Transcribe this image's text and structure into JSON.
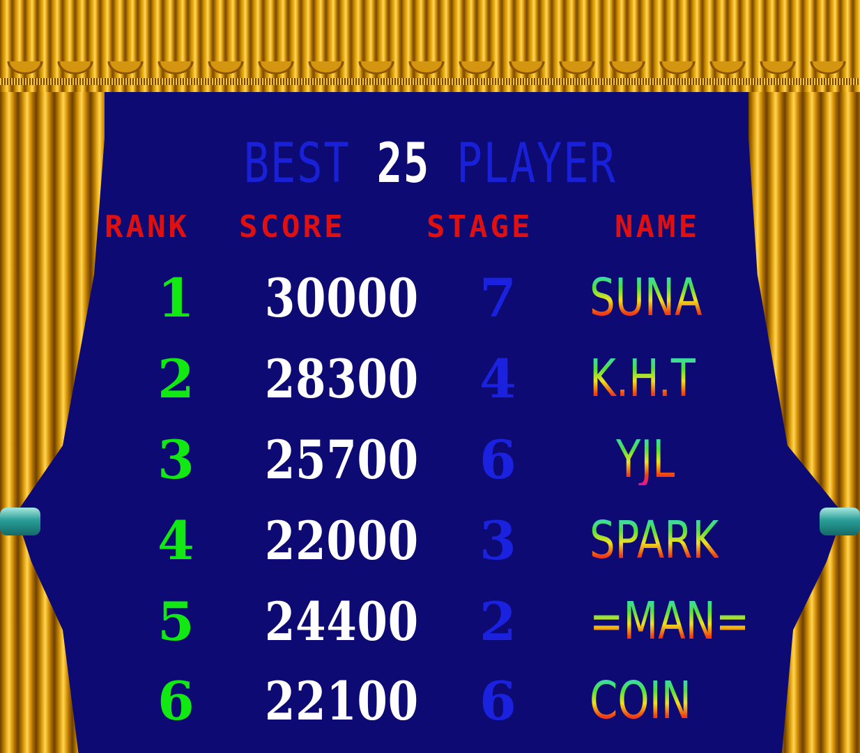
{
  "title": {
    "part1": "BEST",
    "part2": "25",
    "part3": "PLAYER"
  },
  "headers": {
    "rank": "RANK",
    "score": "SCORE",
    "stage": "STAGE",
    "name": "NAME"
  },
  "rows": [
    {
      "rank": "1",
      "score": "30000",
      "stage": "7",
      "name": "SUNA"
    },
    {
      "rank": "2",
      "score": "28300",
      "stage": "4",
      "name": "K.H.T"
    },
    {
      "rank": "3",
      "score": "25700",
      "stage": "6",
      "name": "YJL"
    },
    {
      "rank": "4",
      "score": "22000",
      "stage": "3",
      "name": "SPARK"
    },
    {
      "rank": "5",
      "score": "24400",
      "stage": "2",
      "name": "=MAN="
    },
    {
      "rank": "6",
      "score": "22100",
      "stage": "6",
      "name": "COIN"
    }
  ],
  "colors": {
    "background": "#0d0b73",
    "title_blue": "#1820d8",
    "header_red": "#e01010",
    "rank_green": "#12e812",
    "score_white": "#ffffff",
    "stage_blue": "#1a22e0",
    "curtain_gold": "#f0b420"
  }
}
